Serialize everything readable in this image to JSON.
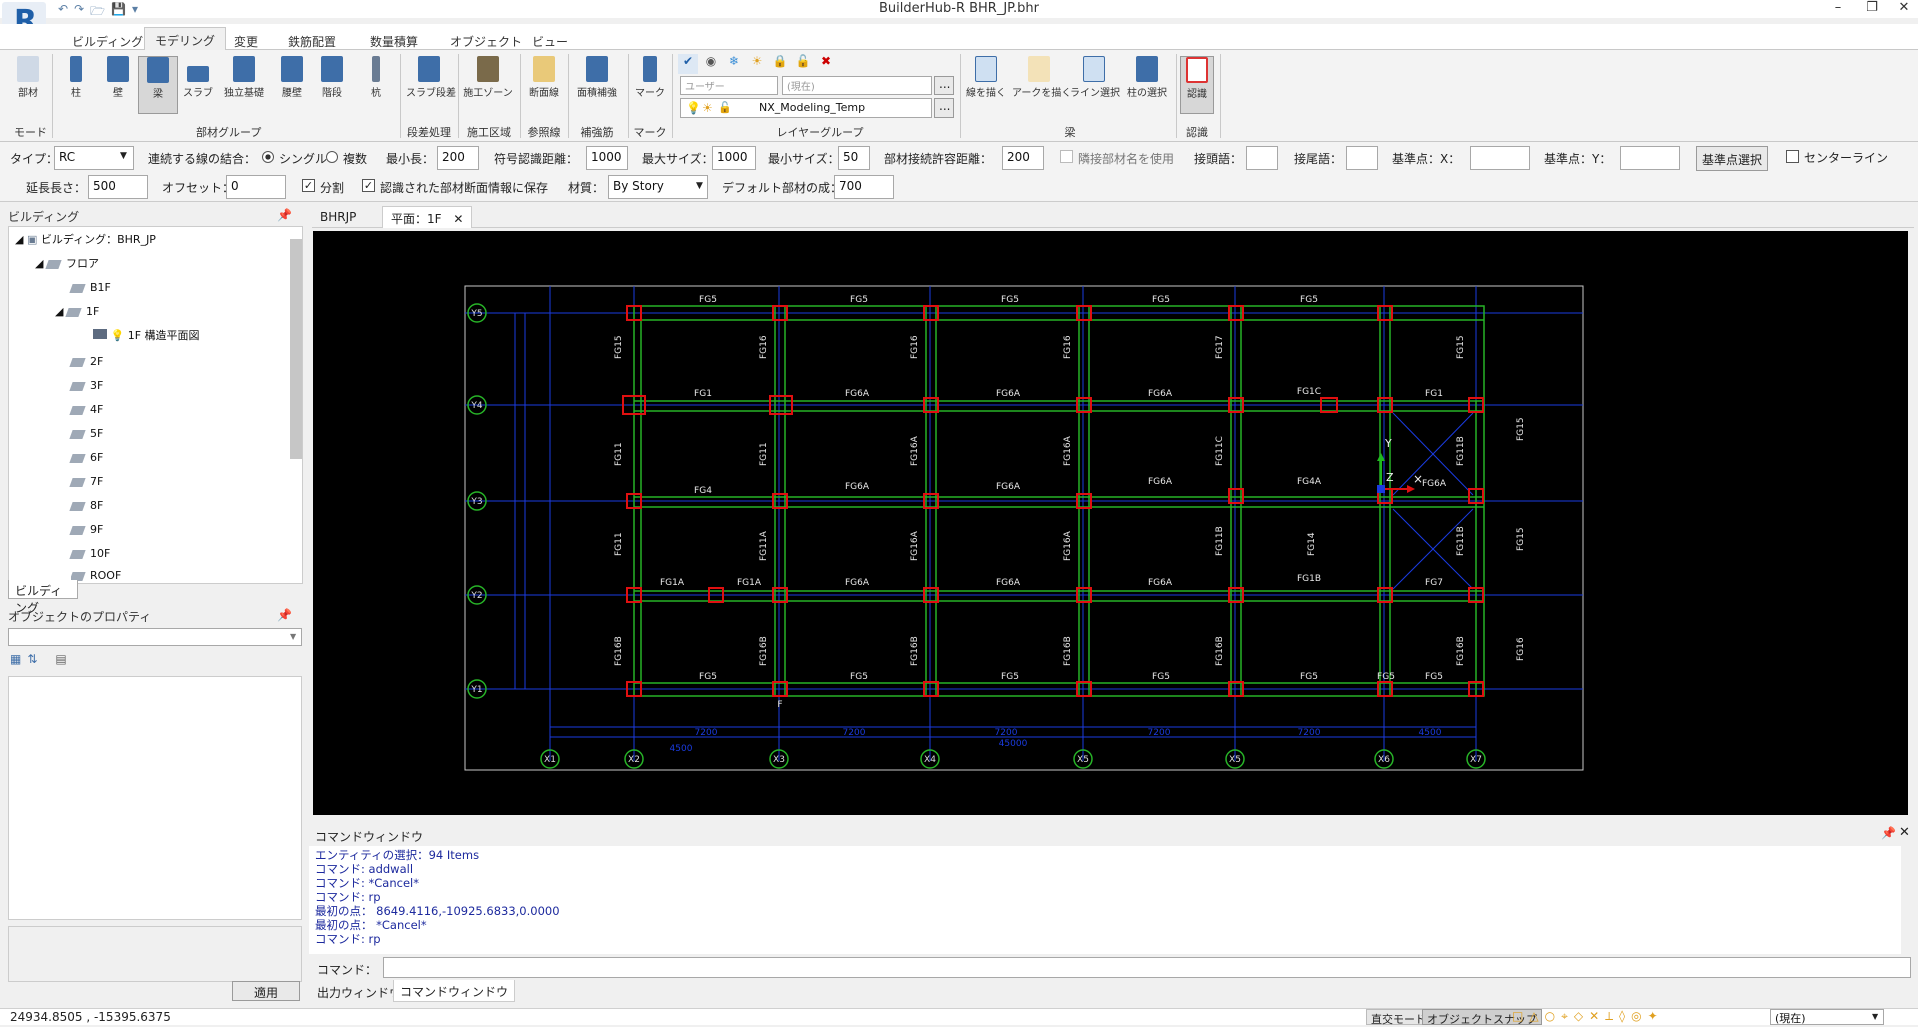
{
  "app": {
    "title": "BuilderHub-R BHR_JP.bhr",
    "logo": "R",
    "qat_icons": [
      "undo-icon",
      "redo-icon",
      "open-icon",
      "save-icon",
      "more-icon"
    ]
  },
  "tabs": [
    "ビルディング",
    "モデリング",
    "変更",
    "鉄筋配置",
    "数量積算",
    "オブジェクト",
    "ビュー"
  ],
  "active_tab": "モデリング",
  "ribbon": {
    "buttons": [
      "部材",
      "柱",
      "壁",
      "梁",
      "スラブ",
      "独立基礎",
      "腰壁",
      "階段",
      "杭",
      "スラブ段差",
      "施工ゾーン",
      "断面線",
      "面積補強",
      "マーク",
      "線を描く",
      "アークを描く",
      "ライン選択",
      "柱の選択",
      "認識"
    ],
    "groups": [
      "モード",
      "部材グループ",
      "段差処理",
      "施工区域",
      "参照線",
      "補強筋",
      "マーク",
      "レイヤーグループ",
      "梁",
      "認識"
    ],
    "layer": {
      "user_placeholder": "ユーザー",
      "current_placeholder": "(現在)",
      "layer_name": "NX_Modeling_Temp",
      "more": "..."
    }
  },
  "options": {
    "type_label": "タイプ：",
    "type_value": "RC",
    "join_label": "連続する線の結合：",
    "single": "シングル",
    "multi": "複数",
    "min_len_label": "最小長：",
    "min_len": "200",
    "sign_dist_label": "符号認識距離：",
    "sign_dist": "1000",
    "max_size_label": "最大サイズ：",
    "max_size": "1000",
    "min_size_label": "最小サイズ：",
    "min_size": "50",
    "tol_label": "部材接続許容距離：",
    "tol": "200",
    "adj_label": "隣接部材名を使用",
    "prefix_label": "接頭語：",
    "suffix_label": "接尾語：",
    "bx_label": "基準点：X：",
    "by_label": "基準点：Y：",
    "base_btn": "基準点選択",
    "center_label": "センターライン",
    "ext_label": "延長長さ：",
    "ext": "500",
    "offset_label": "オフセット：",
    "offset": "0",
    "split_label": "分割",
    "save_label": "認識された部材断面情報に保存",
    "material_label": "材質：",
    "material": "By Story",
    "default_label": "デフォルト部材の成：",
    "default_depth": "700"
  },
  "left": {
    "title": "ビルディング",
    "tree": {
      "building": "ビルディング：BHR_JP",
      "floor_group": "フロア",
      "floors": [
        "B1F",
        "1F",
        "2F",
        "3F",
        "4F",
        "5F",
        "6F",
        "7F",
        "8F",
        "9F",
        "10F",
        "ROOF"
      ],
      "plan": "1F 構造平面図"
    },
    "tab": "ビルディング",
    "props_title": "オブジェクトのプロパティ",
    "apply": "適用"
  },
  "doc_tabs": [
    "BHRJP",
    "平面：1F"
  ],
  "drawing": {
    "x_grids": [
      "X1",
      "X2",
      "X3",
      "X4",
      "X5",
      "X5",
      "X6",
      "X7"
    ],
    "y_grids": [
      "Y5",
      "Y4",
      "Y3",
      "Y2",
      "Y1"
    ],
    "row_y5": [
      "FG5",
      "FG5",
      "FG5",
      "FG5",
      "FG5"
    ],
    "row_y4": [
      "FG1",
      "FG6A",
      "FG6A",
      "FG6A",
      "FG1C",
      "FG1"
    ],
    "row_y3": [
      "FG4",
      "FG6A",
      "FG6A",
      "FG6A",
      "FG4A",
      "FG6A"
    ],
    "row_y2": [
      "FG1A",
      "FG1A",
      "FG6A",
      "FG6A",
      "FG6A",
      "FG1B",
      "FG7"
    ],
    "row_y1": [
      "FG5",
      "FG5",
      "FG5",
      "FG5",
      "FG5",
      "FG5",
      "FG5"
    ],
    "col_top": [
      "FG15",
      "FG16",
      "FG16",
      "FG16",
      "FG17",
      "FG15"
    ],
    "col_mid": [
      "FG11",
      "FG11",
      "FG16A",
      "FG16A",
      "FG11C",
      "FG11B",
      "FG15"
    ],
    "col_mid2": [
      "FG11",
      "FG11A",
      "FG16A",
      "FG16A",
      "FG11B",
      "FG14",
      "FG11B",
      "FG15"
    ],
    "col_bot": [
      "FG16B",
      "FG16B",
      "FG16B",
      "FG16B",
      "FG16B",
      "FG16B",
      "FG16"
    ],
    "dims": [
      "4500",
      "7200",
      "7200",
      "7200",
      "7200",
      "7200",
      "4500"
    ],
    "total_dim": "45000",
    "axis": {
      "y": "Y",
      "z": "Z"
    },
    "extra": "F"
  },
  "cmd": {
    "title": "コマンドウィンドウ",
    "log": [
      "エンティティの選択：94 Items",
      "コマンド: addwall",
      "コマンド: *Cancel*",
      "コマンド: rp",
      "最初の点： 8649.4116,-10925.6833,0.0000",
      "最初の点： *Cancel*",
      "コマンド: rp"
    ],
    "prompt": "コマンド：",
    "tabs": [
      "出力ウィンドウ",
      "コマンドウィンドウ"
    ]
  },
  "status": {
    "coords": "24934.8505 , -15395.6375",
    "ortho": "直交モード",
    "osnap": "オブジェクトスナップ",
    "current": "(現在)"
  }
}
